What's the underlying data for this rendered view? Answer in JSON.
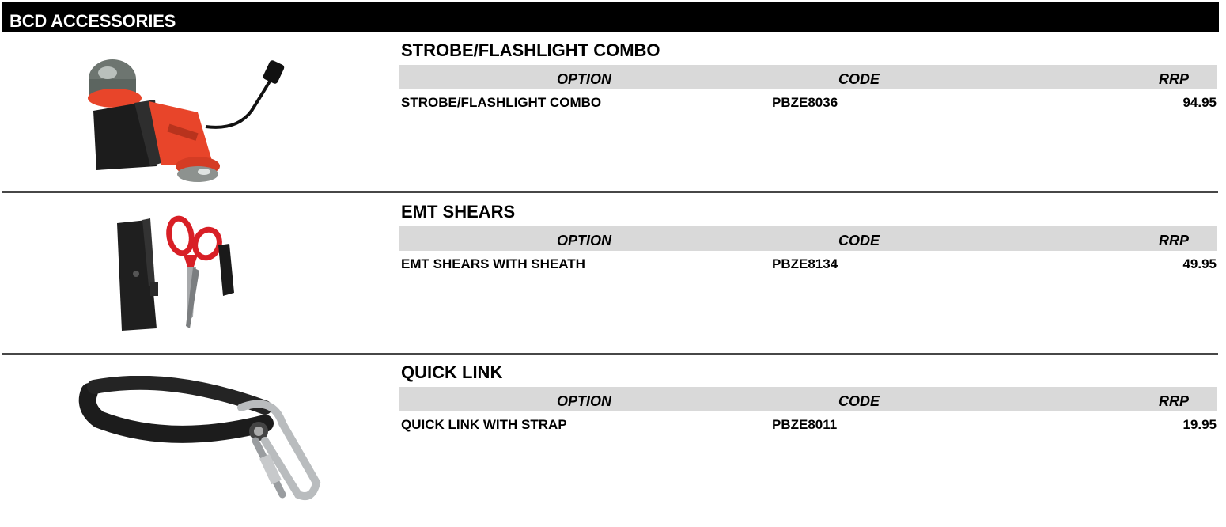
{
  "header": {
    "title": "BCD ACCESSORIES"
  },
  "table_headers": {
    "option": "OPTION",
    "code": "CODE",
    "rrp": "RRP"
  },
  "products": [
    {
      "title": "STROBE/FLASHLIGHT COMBO",
      "image": "strobe-flashlight-photo",
      "rows": [
        {
          "option": "STROBE/FLASHLIGHT COMBO",
          "code": "PBZE8036",
          "rrp": "94.95"
        }
      ]
    },
    {
      "title": "EMT SHEARS",
      "image": "emt-shears-photo",
      "rows": [
        {
          "option": "EMT SHEARS WITH SHEATH",
          "code": "PBZE8134",
          "rrp": "49.95"
        }
      ]
    },
    {
      "title": "QUICK LINK",
      "image": "quick-link-photo",
      "rows": [
        {
          "option": "QUICK LINK WITH STRAP",
          "code": "PBZE8011",
          "rrp": "19.95"
        }
      ]
    }
  ],
  "colors": {
    "header_bg": "#000000",
    "header_text": "#ffffff",
    "table_header_bg": "#d9d9d9",
    "divider": "#474747",
    "strobe_orange": "#e8452a"
  }
}
